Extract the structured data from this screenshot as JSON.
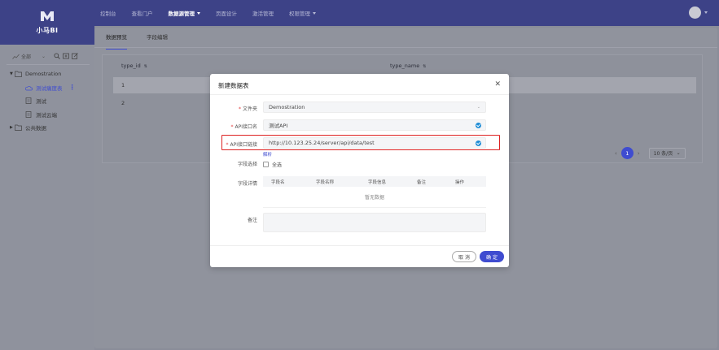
{
  "app": {
    "logo_text": "小马BI"
  },
  "nav": {
    "items": [
      {
        "label": "控制台",
        "active": false,
        "dropdown": false
      },
      {
        "label": "查看门户",
        "active": false,
        "dropdown": false
      },
      {
        "label": "数据源管理",
        "active": true,
        "dropdown": true
      },
      {
        "label": "页面设计",
        "active": false,
        "dropdown": false
      },
      {
        "label": "激活管理",
        "active": false,
        "dropdown": false
      },
      {
        "label": "权限管理",
        "active": false,
        "dropdown": true
      }
    ]
  },
  "sidebar": {
    "filter_label": "全部",
    "tree": [
      {
        "label": "Demostration",
        "level": 0,
        "expanded": true
      },
      {
        "label": "测试痛度表",
        "level": 1,
        "selected": true
      },
      {
        "label": "测试",
        "level": 1,
        "selected": false
      },
      {
        "label": "测试云端",
        "level": 1,
        "selected": false
      },
      {
        "label": "公共数据",
        "level": 0,
        "expanded": false
      }
    ]
  },
  "tabs": [
    {
      "label": "数据预览",
      "active": true
    },
    {
      "label": "字段编辑",
      "active": false
    }
  ],
  "table": {
    "columns": [
      "type_id",
      "type_name"
    ],
    "rows": [
      {
        "type_id": "1",
        "type_name": ""
      },
      {
        "type_id": "2",
        "type_name": ""
      }
    ]
  },
  "pager": {
    "current": "1",
    "page_size": "10 条/页"
  },
  "modal": {
    "title": "新建数据表",
    "fields": {
      "folder_label": "文件夹",
      "folder_value": "Demostration",
      "api_name_label": "API接口名",
      "api_name_value": "测试API",
      "api_url_label": "API接口链接",
      "api_url_value": "http://10.123.25.24/server/api/data/test",
      "parse_link": "解析",
      "field_select_label": "字段选择",
      "select_all": "全选",
      "field_detail_label": "字段详情",
      "remark_label": "备注"
    },
    "inner_table": {
      "columns": [
        "字段名",
        "字段名称",
        "字段信息",
        "备注",
        "操作"
      ],
      "empty_text": "暂无数据"
    },
    "cancel_label": "取 消",
    "ok_label": "确 定"
  },
  "colors": {
    "accent": "#3f4cd0",
    "topbar": "#3d4287",
    "highlight": "#dd2222"
  }
}
